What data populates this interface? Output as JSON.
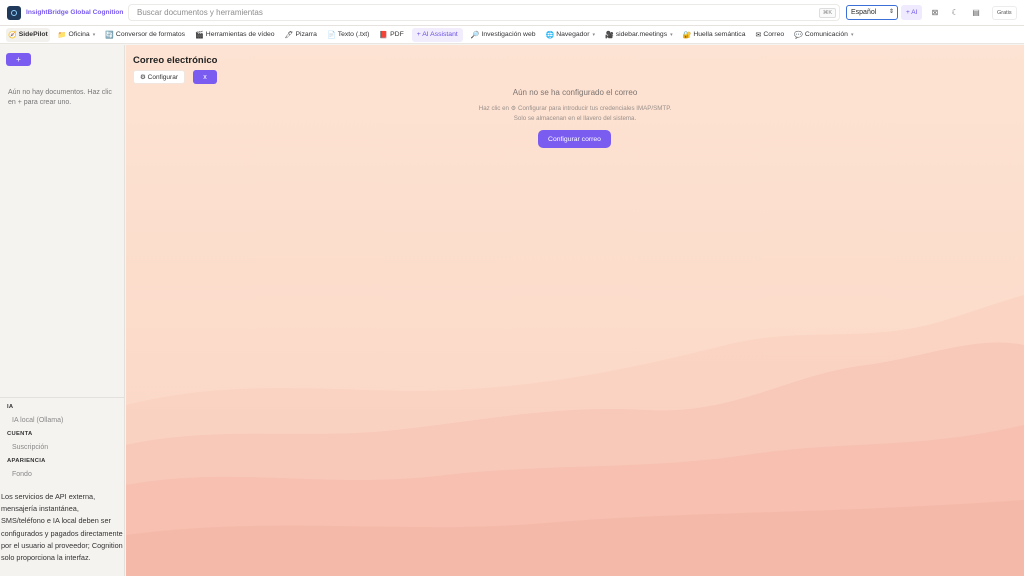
{
  "header": {
    "brand": "InsightBridge Global Cognition",
    "search_placeholder": "Buscar documentos y herramientas",
    "search_shortcut": "⌘K",
    "language": "Español",
    "ai_button": "+ AI",
    "plan_badge": "Gratis",
    "icons": [
      "grid-icon",
      "moon-icon",
      "printer-icon"
    ]
  },
  "toolbar": {
    "items": [
      {
        "label": "SidePilot",
        "icon": "🧭",
        "dropdown": false
      },
      {
        "label": "Oficina",
        "icon": "📁",
        "dropdown": true
      },
      {
        "label": "Conversor de formatos",
        "icon": "🔄",
        "dropdown": false
      },
      {
        "label": "Herramientas de vídeo",
        "icon": "🎬",
        "dropdown": false
      },
      {
        "label": "Pizarra",
        "icon": "🖊",
        "dropdown": false
      },
      {
        "label": "Texto (.txt)",
        "icon": "📄",
        "dropdown": false
      },
      {
        "label": "PDF",
        "icon": "📕",
        "dropdown": false
      },
      {
        "label": "+ AI Assistant",
        "icon": "",
        "dropdown": false
      },
      {
        "label": "Investigación web",
        "icon": "🔎",
        "dropdown": false
      },
      {
        "label": "Navegador",
        "icon": "🌐",
        "dropdown": true
      },
      {
        "label": "sidebar.meetings",
        "icon": "🎥",
        "dropdown": true
      },
      {
        "label": "Huella semántica",
        "icon": "🔐",
        "dropdown": false
      },
      {
        "label": "Correo",
        "icon": "✉",
        "dropdown": false
      },
      {
        "label": "Comunicación",
        "icon": "💬",
        "dropdown": true
      }
    ]
  },
  "sidebar": {
    "new_button": "+",
    "empty_text": "Aún no hay documentos. Haz clic en + para crear uno.",
    "sections": [
      {
        "heading": "IA",
        "items": [
          "IA local (Ollama)"
        ]
      },
      {
        "heading": "CUENTA",
        "items": [
          "Suscripción"
        ]
      },
      {
        "heading": "APARIENCIA",
        "items": [
          "Fondo"
        ]
      }
    ],
    "disclaimer": "Los servicios de API externa, mensajería instantánea, SMS/teléfono e IA local deben ser configurados y pagados directamente por el usuario al proveedor; Cognition solo proporciona la interfaz."
  },
  "main": {
    "title": "Correo electrónico",
    "configure_button": "⚙ Configurar",
    "close_button": "x",
    "empty_title": "Aún no se ha configurado el correo",
    "empty_line1": "Haz clic en ⚙ Configurar para introducir tus credenciales IMAP/SMTP.",
    "empty_line2": "Solo se almacenan en el llavero del sistema.",
    "setup_button": "Configurar correo"
  },
  "colors": {
    "accent": "#7a5cf0",
    "background_peach": "#fde3d3",
    "mountain": "#f6c1b3"
  }
}
